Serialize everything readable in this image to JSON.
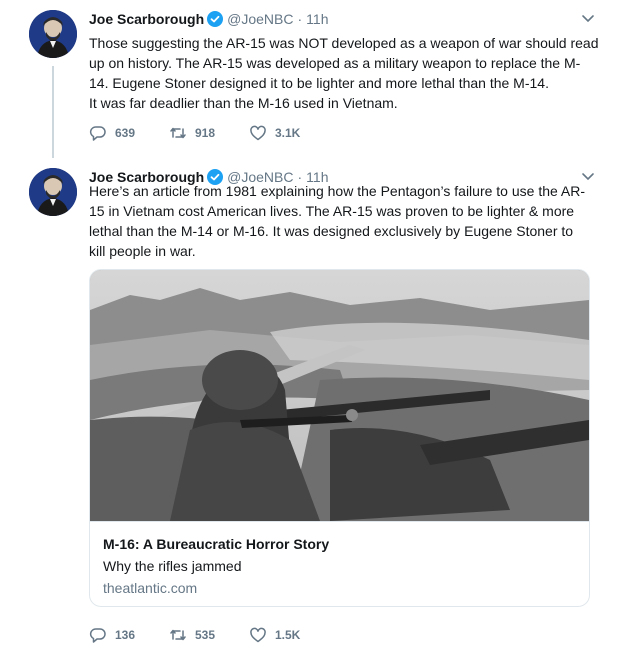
{
  "colors": {
    "text": "#14171a",
    "secondary": "#657786",
    "verified_blue": "#1da1f2",
    "thread_line": "#ccd6dd",
    "border": "#e1e8ed"
  },
  "tweets": [
    {
      "name": "Joe Scarborough",
      "verified": true,
      "handle": "@JoeNBC",
      "separator": "·",
      "time": "11h",
      "text_lines": [
        "Those suggesting the AR-15 was NOT developed as a weapon of war should read",
        "up on history. The AR-15 was developed as a military weapon to replace the M-",
        "14. Eugene Stoner designed it to be lighter and more lethal than the M-14.",
        "It was far deadlier than the M-16 used in Vietnam."
      ],
      "replies": "639",
      "retweets": "918",
      "likes": "3.1K",
      "icons": [
        "avatar",
        "verified-badge-icon",
        "chevron-down-icon",
        "reply-icon",
        "retweet-icon",
        "like-icon"
      ]
    },
    {
      "name": "Joe Scarborough",
      "verified": true,
      "handle": "@JoeNBC",
      "separator": "·",
      "time": "11h",
      "text_lines": [
        "Here’s an article from 1981 explaining how the Pentagon’s failure to use the AR-",
        "15 in Vietnam cost American lives. The AR-15 was proven to be lighter & more",
        "lethal than the M-14 or M-16. It was designed exclusively by Eugene Stoner to",
        "kill people in war."
      ],
      "card": {
        "image_description": "black-and-white photo of a soldier aiming a rifle beside a mounted gun in Vietnam",
        "title": "M-16: A Bureaucratic Horror Story",
        "description": "Why the rifles jammed",
        "domain": "theatlantic.com"
      },
      "replies": "136",
      "retweets": "535",
      "likes": "1.5K",
      "icons": [
        "avatar",
        "verified-badge-icon",
        "chevron-down-icon",
        "reply-icon",
        "retweet-icon",
        "like-icon"
      ]
    }
  ]
}
